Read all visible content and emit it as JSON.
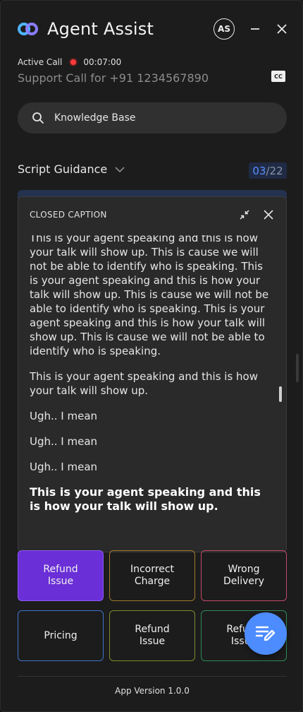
{
  "header": {
    "title": "Agent Assist",
    "avatar_initials": "AS",
    "icons": [
      "logo-icon",
      "minimize-icon",
      "close-icon"
    ]
  },
  "call": {
    "status_label": "Active Call",
    "timer": "00:07:00",
    "description": "Support Call for +91 1234567890",
    "cc_label": "CC"
  },
  "search": {
    "placeholder": "Knowledge Base"
  },
  "script_guidance": {
    "label": "Script Guidance",
    "current": "03",
    "total": "/22"
  },
  "closed_caption": {
    "title": "CLOSED CAPTION",
    "paragraphs": [
      "This is your agent speaking and this is how your talk will show up. This is cause we will not be able to identify who is speaking. This is your agent speaking and this is how your talk will show up. This is cause we will not be able to identify who is speaking. This is your agent speaking and this is how your talk will show up. This is cause we will not be able to identify who is speaking.",
      "This is your agent speaking and this is how your talk will show up.",
      "Ugh.. I mean",
      "Ugh.. I mean",
      "Ugh.. I mean",
      "This is your agent speaking and this is how your talk will show up."
    ]
  },
  "intents": [
    {
      "label": "Refund\nIssue",
      "line1": "Refund",
      "line2": "Issue",
      "color": "#6a2fd6",
      "selected": true
    },
    {
      "label": "Incorrect Charge",
      "line1": "Incorrect",
      "line2": "Charge",
      "color": "#a07a2a"
    },
    {
      "label": "Wrong Delivery",
      "line1": "Wrong",
      "line2": "Delivery",
      "color": "#c34a6a"
    },
    {
      "label": "Pricing",
      "line1": "Pricing",
      "line2": "",
      "color": "#3f73c9"
    },
    {
      "label": "Refund Issue",
      "line1": "Refund",
      "line2": "Issue",
      "color": "#7e8a2c"
    },
    {
      "label": "Refund Issue",
      "line1": "Refund",
      "line2": "Issue",
      "color": "#2f8a5a"
    }
  ],
  "footer": {
    "version": "App Version 1.0.0"
  },
  "colors": {
    "accent": "#4d8cff",
    "recording": "#ff3b3b",
    "background": "#1c1c1c"
  }
}
